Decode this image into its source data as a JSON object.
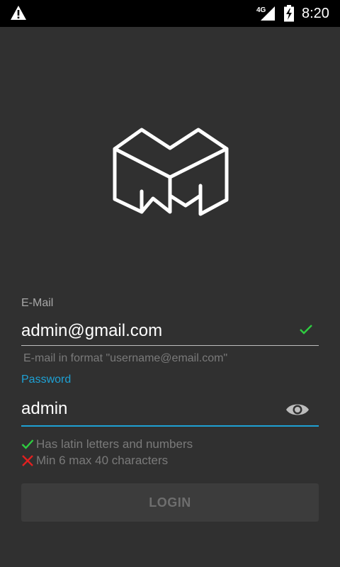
{
  "status_bar": {
    "network": "4G",
    "time": "8:20",
    "icons": [
      "warning-icon",
      "signal-icon",
      "battery-charging-icon"
    ]
  },
  "logo": {
    "icon": "m-cube-logo"
  },
  "email": {
    "label": "E-Mail",
    "value": "admin@gmail.com",
    "hint": "E-mail in format \"username@email.com\"",
    "valid_icon": "check-icon"
  },
  "password": {
    "label": "Password",
    "value": "admin",
    "toggle_icon": "eye-icon"
  },
  "rules": [
    {
      "text": "Has latin letters and numbers",
      "ok": true
    },
    {
      "text": "Min 6 max 40 characters",
      "ok": false
    }
  ],
  "login": {
    "label": "LOGIN"
  },
  "colors": {
    "background": "#303030",
    "accent": "#1ea1d4",
    "valid": "#2ecc40",
    "invalid": "#e02020",
    "button_bg": "#3c3c3c",
    "button_text": "#6e6e6e"
  }
}
